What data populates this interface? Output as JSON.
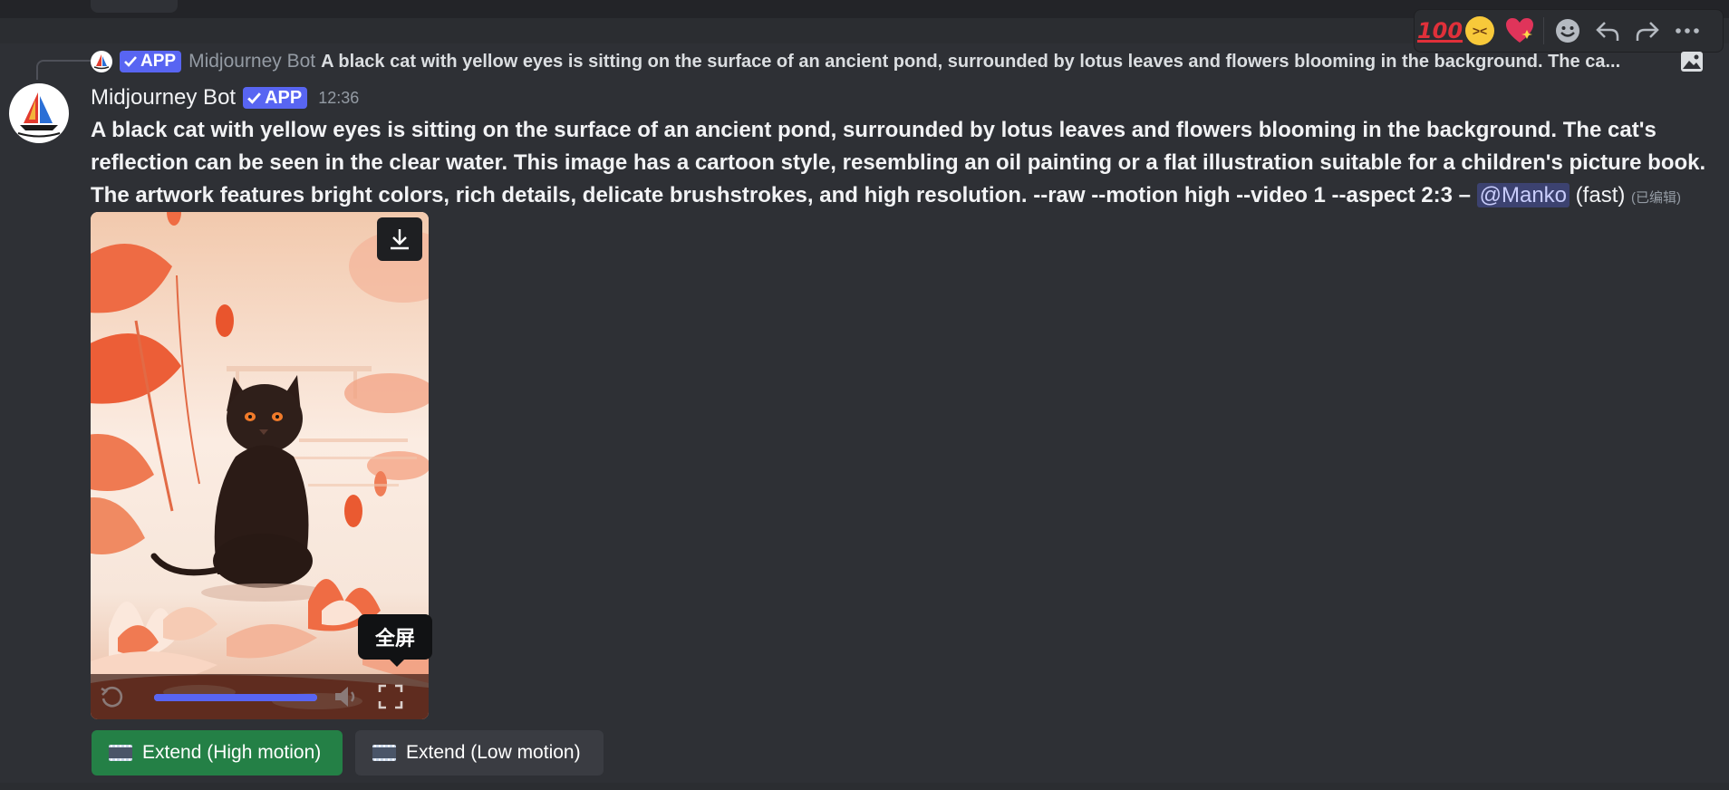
{
  "toolbar": {
    "reactions": [
      "100-emoji",
      "laughing-face-emoji",
      "sparkling-heart-emoji"
    ],
    "emoji_100_text": "100",
    "actions": [
      "add-reaction",
      "reply",
      "forward",
      "more"
    ]
  },
  "reply": {
    "badge": "APP",
    "author": "Midjourney Bot",
    "text": "A black cat with yellow eyes is sitting on the surface of an ancient pond, surrounded by lotus leaves and flowers blooming in the background. The ca..."
  },
  "message": {
    "author": "Midjourney Bot",
    "badge": "APP",
    "timestamp": "12:36",
    "prompt": "A black cat with yellow eyes is sitting on the surface of an ancient pond, surrounded by lotus leaves and flowers blooming in the background. The cat's reflection can be seen in the clear water. This image has a cartoon style, resembling an oil painting or a flat illustration suitable for a children's picture book. The artwork features bright colors, rich details, delicate brushstrokes, and high resolution. --raw --motion high --video 1 --aspect 2:3",
    "dash": " – ",
    "mention": "@Manko",
    "speed": " (fast)",
    "edited": "(已编辑)"
  },
  "video": {
    "progress_fraction": 1.0,
    "tooltip": "全屏"
  },
  "buttons": {
    "extend_high": "Extend (High motion)",
    "extend_low": "Extend (Low motion)"
  },
  "colors": {
    "accent": "#5865f2",
    "success": "#248046",
    "mention_bg": "#3c4270"
  }
}
